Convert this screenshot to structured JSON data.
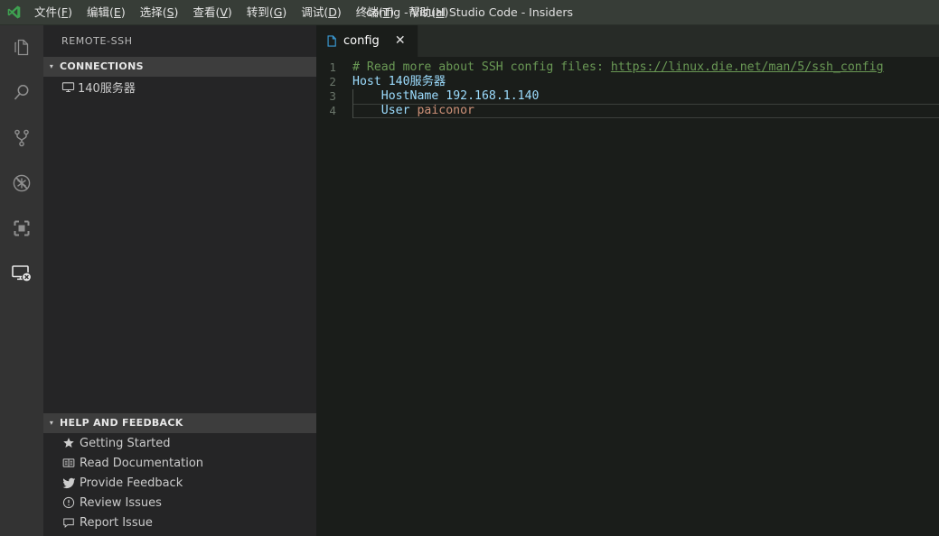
{
  "titlebar": {
    "logo_icon": "vscode-insiders-logo",
    "window_title": "config - Visual Studio Code - Insiders",
    "menus": [
      {
        "label": "文件",
        "mnemonic": "F"
      },
      {
        "label": "编辑",
        "mnemonic": "E"
      },
      {
        "label": "选择",
        "mnemonic": "S"
      },
      {
        "label": "查看",
        "mnemonic": "V"
      },
      {
        "label": "转到",
        "mnemonic": "G"
      },
      {
        "label": "调试",
        "mnemonic": "D"
      },
      {
        "label": "终端",
        "mnemonic": "T"
      },
      {
        "label": "帮助",
        "mnemonic": "H"
      }
    ]
  },
  "activitybar": {
    "items": [
      {
        "name": "explorer",
        "icon": "files-icon",
        "active": false
      },
      {
        "name": "search",
        "icon": "search-icon",
        "active": false
      },
      {
        "name": "source-control",
        "icon": "source-control-icon",
        "active": false
      },
      {
        "name": "run-and-debug",
        "icon": "debug-disabled-icon",
        "active": false
      },
      {
        "name": "extensions",
        "icon": "extensions-icon",
        "active": false
      },
      {
        "name": "remote-explorer",
        "icon": "remote-explorer-icon",
        "active": true
      }
    ]
  },
  "sidebar": {
    "title": "REMOTE-SSH",
    "connections": {
      "header": "CONNECTIONS",
      "expanded": true,
      "items": [
        {
          "label": "140服务器",
          "icon": "monitor-icon"
        }
      ]
    },
    "help_and_feedback": {
      "header": "HELP AND FEEDBACK",
      "expanded": true,
      "items": [
        {
          "label": "Getting Started",
          "icon": "star-icon"
        },
        {
          "label": "Read Documentation",
          "icon": "book-icon"
        },
        {
          "label": "Provide Feedback",
          "icon": "twitter-icon"
        },
        {
          "label": "Review Issues",
          "icon": "issues-icon"
        },
        {
          "label": "Report Issue",
          "icon": "comment-icon"
        }
      ]
    }
  },
  "editor": {
    "tabs": [
      {
        "label": "config",
        "icon": "file-icon",
        "close_icon": "✕",
        "active": true
      }
    ],
    "file": {
      "lines": [
        {
          "number": "1",
          "segments": [
            {
              "text": "# Read more about SSH config files: ",
              "kind": "comment"
            },
            {
              "text": "https://linux.die.net/man/5/ssh_config",
              "kind": "link"
            }
          ]
        },
        {
          "number": "2",
          "segments": [
            {
              "text": "Host",
              "kind": "key"
            },
            {
              "text": " ",
              "kind": "plain"
            },
            {
              "text": "140服务器",
              "kind": "val"
            }
          ]
        },
        {
          "number": "3",
          "indent": true,
          "segments": [
            {
              "text": "    ",
              "kind": "plain"
            },
            {
              "text": "HostName",
              "kind": "key"
            },
            {
              "text": " ",
              "kind": "plain"
            },
            {
              "text": "192.168.1.140",
              "kind": "val"
            }
          ]
        },
        {
          "number": "4",
          "indent": true,
          "current": true,
          "segments": [
            {
              "text": "    ",
              "kind": "plain"
            },
            {
              "text": "User",
              "kind": "key"
            },
            {
              "text": " ",
              "kind": "plain"
            },
            {
              "text": "paiconor",
              "kind": "str"
            }
          ]
        }
      ]
    }
  },
  "colors": {
    "titlebar_bg": "#373d37",
    "activitybar_bg": "#333333",
    "sidebar_bg": "#252526",
    "editor_bg": "#1a1d1a",
    "tabbar_bg": "#272b27",
    "comment": "#6A9955",
    "keyword": "#9CDCFE",
    "string": "#CE9178",
    "accent_green": "#3EA150"
  }
}
